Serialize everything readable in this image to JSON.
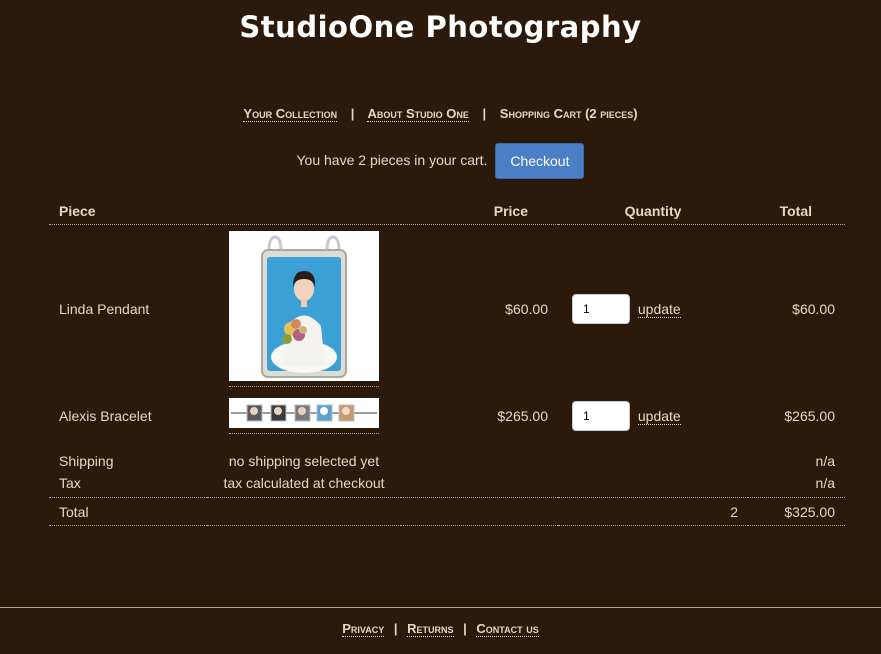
{
  "site": {
    "title": "StudioOne Photography"
  },
  "nav": {
    "collection": "Your Collection",
    "about": "About Studio One",
    "cart": "Shopping Cart (2 pieces)",
    "separator": "|"
  },
  "cart_message": {
    "text": "You have 2 pieces in your cart.",
    "checkout_label": "Checkout"
  },
  "table": {
    "headers": {
      "piece": "Piece",
      "price": "Price",
      "quantity": "Quantity",
      "total": "Total"
    },
    "items": [
      {
        "name": "Linda Pendant",
        "price": "$60.00",
        "quantity": "1",
        "update_label": "update",
        "total": "$60.00"
      },
      {
        "name": "Alexis Bracelet",
        "price": "$265.00",
        "quantity": "1",
        "update_label": "update",
        "total": "$265.00"
      }
    ],
    "shipping": {
      "label": "Shipping",
      "note": "no shipping selected yet",
      "value": "n/a"
    },
    "tax": {
      "label": "Tax",
      "note": "tax calculated at checkout",
      "value": "n/a"
    },
    "total": {
      "label": "Total",
      "count": "2",
      "value": "$325.00"
    }
  },
  "footer": {
    "privacy": "Privacy",
    "returns": "Returns",
    "contact": "Contact us",
    "separator": "|"
  },
  "colors": {
    "background": "#2b1a0b",
    "text": "#e6d7c3",
    "button": "#4a7ec5"
  }
}
